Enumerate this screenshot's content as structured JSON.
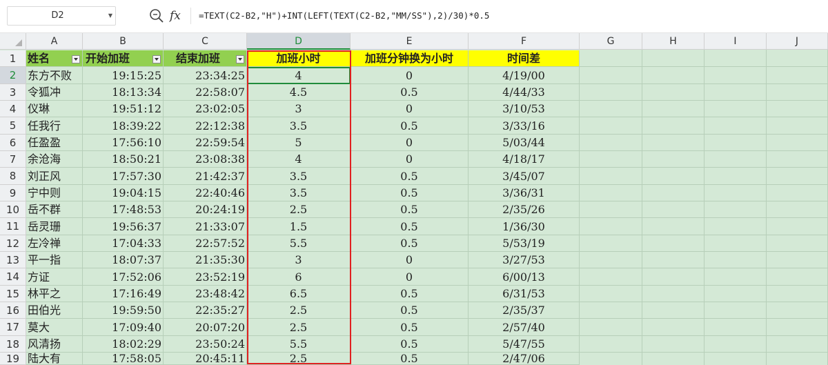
{
  "formula_bar": {
    "name_box": "D2",
    "fx_label": "fx",
    "formula": "=TEXT(C2-B2,\"H\")+INT(LEFT(TEXT(C2-B2,\"MM/SS\"),2)/30)*0.5"
  },
  "sheet": {
    "columns": [
      "A",
      "B",
      "C",
      "D",
      "E",
      "F",
      "G",
      "H",
      "I",
      "J"
    ],
    "row_numbers": [
      "1",
      "2",
      "3",
      "4",
      "5",
      "6",
      "7",
      "8",
      "9",
      "10",
      "11",
      "12",
      "13",
      "14",
      "15",
      "16",
      "17",
      "18",
      "19"
    ],
    "headers": [
      "姓名",
      "开始加班",
      "结束加班",
      "加班小时",
      "加班分钟换为小时",
      "时间差"
    ],
    "rows": [
      [
        "东方不败",
        "19:15:25",
        "23:34:25",
        "4",
        "0",
        "4/19/00"
      ],
      [
        "令狐冲",
        "18:13:34",
        "22:58:07",
        "4.5",
        "0.5",
        "4/44/33"
      ],
      [
        "仪琳",
        "19:51:12",
        "23:02:05",
        "3",
        "0",
        "3/10/53"
      ],
      [
        "任我行",
        "18:39:22",
        "22:12:38",
        "3.5",
        "0.5",
        "3/33/16"
      ],
      [
        "任盈盈",
        "17:56:10",
        "22:59:54",
        "5",
        "0",
        "5/03/44"
      ],
      [
        "余沧海",
        "18:50:21",
        "23:08:38",
        "4",
        "0",
        "4/18/17"
      ],
      [
        "刘正风",
        "17:57:30",
        "21:42:37",
        "3.5",
        "0.5",
        "3/45/07"
      ],
      [
        "宁中则",
        "19:04:15",
        "22:40:46",
        "3.5",
        "0.5",
        "3/36/31"
      ],
      [
        "岳不群",
        "17:48:53",
        "20:24:19",
        "2.5",
        "0.5",
        "2/35/26"
      ],
      [
        "岳灵珊",
        "19:56:37",
        "21:33:07",
        "1.5",
        "0.5",
        "1/36/30"
      ],
      [
        "左冷禅",
        "17:04:33",
        "22:57:52",
        "5.5",
        "0.5",
        "5/53/19"
      ],
      [
        "平一指",
        "18:07:37",
        "21:35:30",
        "3",
        "0",
        "3/27/53"
      ],
      [
        "方证",
        "17:52:06",
        "23:52:19",
        "6",
        "0",
        "6/00/13"
      ],
      [
        "林平之",
        "17:16:49",
        "23:48:42",
        "6.5",
        "0.5",
        "6/31/53"
      ],
      [
        "田伯光",
        "19:59:50",
        "22:35:27",
        "2.5",
        "0.5",
        "2/35/37"
      ],
      [
        "莫大",
        "17:09:40",
        "20:07:20",
        "2.5",
        "0.5",
        "2/57/40"
      ],
      [
        "风清扬",
        "18:02:29",
        "23:50:24",
        "5.5",
        "0.5",
        "5/47/55"
      ],
      [
        "陆大有",
        "17:58:05",
        "20:45:11",
        "2.5",
        "0.5",
        "2/47/06"
      ]
    ],
    "selected_column": "D",
    "selected_row": "2"
  },
  "colors": {
    "header_green": "#92d050",
    "header_yellow": "#ffff00",
    "sheet_background": "#d4e9d6",
    "selection_green": "#1f8c3a",
    "highlight_red": "#e02020"
  }
}
